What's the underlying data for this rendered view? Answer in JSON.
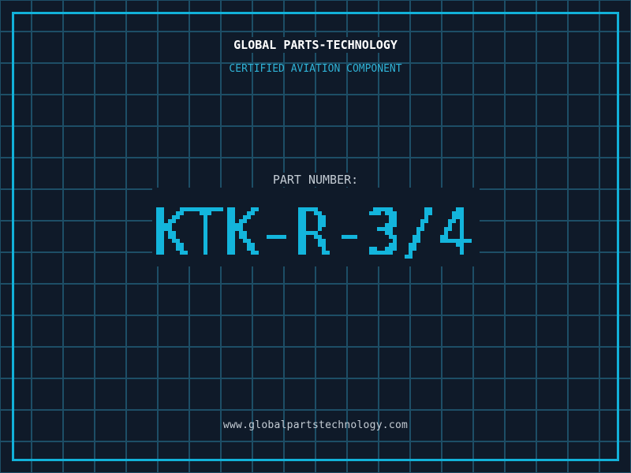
{
  "theme": {
    "background": "#0f1a29",
    "grid_line": "#1d4e66",
    "frame_border": "#12b1d9",
    "title_text": "#ffffff",
    "subtitle_text": "#2fb2d6",
    "muted_text": "#c4ccd4",
    "part_number_text": "#13b5dc"
  },
  "header": {
    "title": "GLOBAL PARTS-TECHNOLOGY",
    "subtitle": "CERTIFIED AVIATION COMPONENT"
  },
  "part": {
    "label": "PART NUMBER:",
    "number": "KTK-R-3/4"
  },
  "footer": {
    "website": "www.globalpartstechnology.com"
  }
}
